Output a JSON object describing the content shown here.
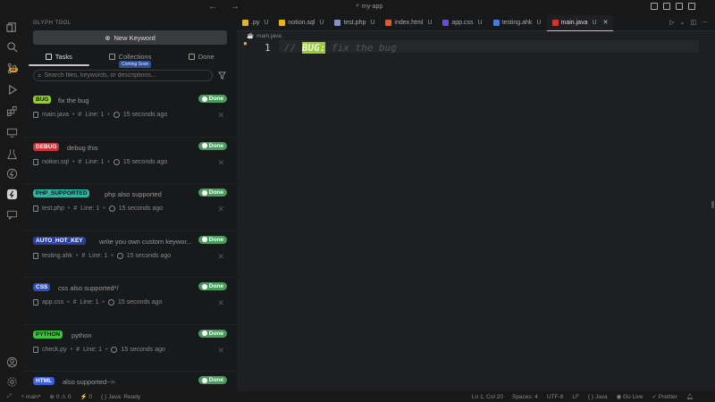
{
  "titlebar": {
    "search_text": "my-app",
    "nav": "← →"
  },
  "activity": {
    "badge": "22"
  },
  "sidebar": {
    "title": "GLYPH TOOL",
    "new_keyword_label": "New Keyword",
    "tabs": [
      {
        "label": "Tasks"
      },
      {
        "label": "Collections"
      },
      {
        "label": "Done"
      }
    ],
    "coming_soon": "Coming Soon",
    "search_placeholder": "Search files, keywords, or descriptions..."
  },
  "tasks": [
    {
      "keyword": "BUG",
      "color": "#8fd31c",
      "desc": "fix the bug",
      "status": "Done",
      "file": "main.java",
      "line": "Line: 1",
      "time": "15 seconds ago"
    },
    {
      "keyword": "DEBUG",
      "color": "#c9333a",
      "desc": "debug this",
      "status": "Done",
      "file": "notion.sql",
      "line": "Line: 1",
      "time": "15 seconds ago"
    },
    {
      "keyword": "PHP_SUPPORTED",
      "color": "#2fb3a0",
      "desc": "php also supported",
      "status": "Done",
      "file": "test.php",
      "line": "Line: 1",
      "time": "15 seconds ago"
    },
    {
      "keyword": "AUTO_HOT_KEY",
      "color": "#2a3ea8",
      "desc": "write you own custom keywor...",
      "status": "Done",
      "file": "testing.ahk",
      "line": "Line: 1",
      "time": "15 seconds ago"
    },
    {
      "keyword": "CSS",
      "color": "#2c4ec4",
      "desc": "css also supported*/",
      "status": "Done",
      "file": "app.css",
      "line": "Line: 1",
      "time": "15 seconds ago"
    },
    {
      "keyword": "PYTHON",
      "color": "#3cc43c",
      "desc": "python",
      "status": "Done",
      "file": "check.py",
      "line": "Line: 1",
      "time": "15 seconds ago"
    },
    {
      "keyword": "HTML",
      "color": "#3b5fd6",
      "desc": "also supported-->",
      "status": "Done",
      "file": "",
      "line": "",
      "time": ""
    }
  ],
  "editor_tabs": [
    {
      "label": ".py",
      "mod": "U",
      "icon_color": "#e6b422"
    },
    {
      "label": "notion.sql",
      "mod": "U",
      "icon_color": "#e6b422"
    },
    {
      "label": "test.php",
      "mod": "U",
      "icon_color": "#8892bf"
    },
    {
      "label": "index.html",
      "mod": "U",
      "icon_color": "#e4582b"
    },
    {
      "label": "app.css",
      "mod": "U",
      "icon_color": "#6a4ccf"
    },
    {
      "label": "testing.ahk",
      "mod": "U",
      "icon_color": "#4a7bd6"
    },
    {
      "label": "main.java",
      "mod": "U",
      "icon_color": "#d0342c"
    }
  ],
  "editor": {
    "breadcrumb": "main.java",
    "line_number": "1",
    "code_prefix": "// ",
    "code_keyword": "BUG:",
    "code_rest": " fix the bug"
  },
  "statusbar": {
    "branch": "main*",
    "errors": "0",
    "warnings": "0",
    "ports": "0",
    "java_status": "Java: Ready",
    "position": "Ln 1, Col 20",
    "spaces": "Spaces: 4",
    "encoding": "UTF-8",
    "eol": "LF",
    "language": "Java",
    "golive": "Go Live",
    "prettier": "Prettier"
  }
}
